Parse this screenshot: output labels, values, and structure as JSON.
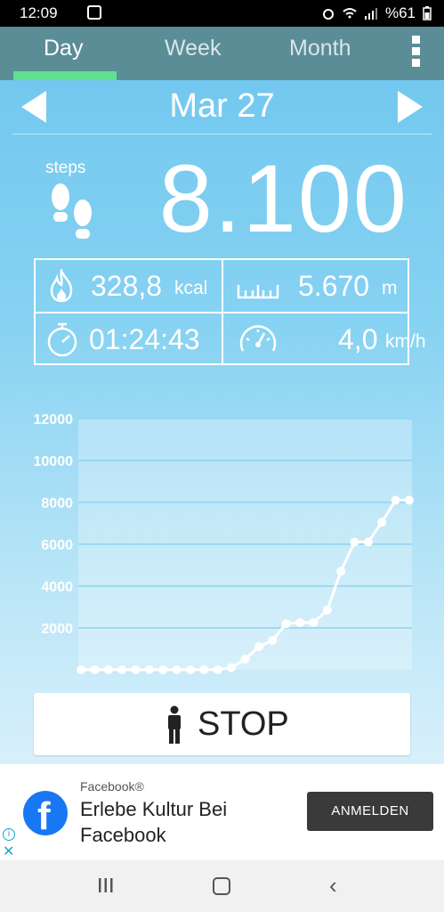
{
  "status_bar": {
    "time": "12:09",
    "battery": "%61"
  },
  "tabs": [
    {
      "label": "Day",
      "active": true
    },
    {
      "label": "Week",
      "active": false
    },
    {
      "label": "Month",
      "active": false
    }
  ],
  "date": "Mar 27",
  "steps": {
    "label": "steps",
    "value": "8.100"
  },
  "stats": {
    "calories": {
      "value": "328,8",
      "unit": "kcal"
    },
    "distance": {
      "value": "5.670",
      "unit": "m"
    },
    "duration": {
      "value": "01:24:43"
    },
    "speed": {
      "value": "4,0",
      "unit": "km/h"
    }
  },
  "chart_data": {
    "type": "line",
    "x": [
      0,
      1,
      2,
      3,
      4,
      5,
      6,
      7,
      8,
      9,
      10,
      11,
      12,
      13,
      14,
      15,
      16,
      17,
      18,
      19,
      20,
      21,
      22,
      23,
      24
    ],
    "values": [
      0,
      0,
      0,
      0,
      0,
      0,
      0,
      0,
      0,
      0,
      0,
      100,
      500,
      1100,
      1400,
      2200,
      2250,
      2250,
      2850,
      4700,
      6100,
      6100,
      7050,
      8100,
      8100
    ],
    "xticks": [
      "2",
      "4",
      "6",
      "8",
      "10",
      "12",
      "14",
      "16",
      "18",
      "20",
      "22",
      "24"
    ],
    "yticks": [
      "2000",
      "4000",
      "6000",
      "8000",
      "10000",
      "12000"
    ],
    "ylim": [
      0,
      12000
    ],
    "xlim": [
      -0.2,
      24.2
    ],
    "grid": true
  },
  "stop_button": {
    "label": "STOP"
  },
  "ad": {
    "source": "Facebook®",
    "headline": "Erlebe Kultur Bei Facebook",
    "cta": "ANMELDEN"
  },
  "colors": {
    "tab_bar": "#5b8d97",
    "tab_indicator": "#5ee08e",
    "chart_line": "#ffffff",
    "chart_grid": "#8fd4ef",
    "ad_button": "#3a3a3a",
    "facebook_blue": "#1877f2"
  }
}
